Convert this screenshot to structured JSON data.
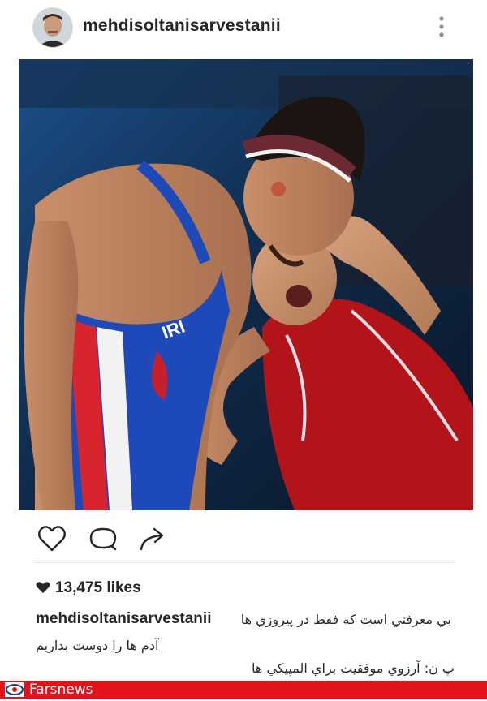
{
  "post": {
    "username": "mehdisoltanisarvestanii",
    "likes": "13,475 likes",
    "caption_user": "mehdisoltanisarvestanii",
    "caption_line1": "بي معرفتي است كه فقط در پيروزي ها",
    "caption_line2": "آدم ها را دوست بداريم",
    "caption_line3": "پ ن: آرزوي موفقيت براي المپيكي ها"
  },
  "photo": {
    "jersey_text": "IRI"
  },
  "footer": {
    "brand": "Farsnews"
  },
  "icons": {
    "more": "more-vertical-icon",
    "like": "heart-icon",
    "comment": "comment-icon",
    "share": "share-icon",
    "likes_heart": "heart-filled-icon",
    "brand_logo": "farsnews-logo-icon"
  },
  "colors": {
    "footer_bg": "#e3121b",
    "text": "#262626"
  }
}
